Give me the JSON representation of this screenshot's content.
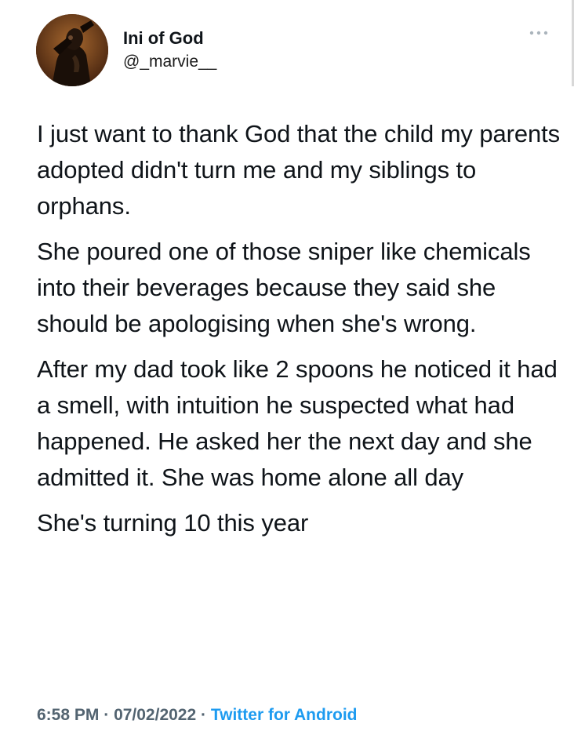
{
  "author": {
    "display_name": "Ini of God",
    "handle": "@_marvie__"
  },
  "icons": {
    "more": "more-horizontal-icon",
    "avatar": "avatar"
  },
  "tweet": {
    "paragraphs": [
      "I just want to thank God that the child my parents adopted didn't turn me and my siblings to orphans.",
      "She poured one of those sniper like chemicals into their beverages because they said she should be apologising when she's wrong.",
      "After my dad took like 2 spoons he noticed it had a smell, with intuition he suspected what had happened. He asked her the next day and she admitted it. She was home alone all day",
      "She's turning 10 this year"
    ]
  },
  "meta": {
    "time": "6:58 PM",
    "separator": "·",
    "date": "07/02/2022",
    "source": "Twitter for Android"
  },
  "colors": {
    "text": "#0f1419",
    "secondary": "#536471",
    "accent": "#1d9bf0"
  }
}
